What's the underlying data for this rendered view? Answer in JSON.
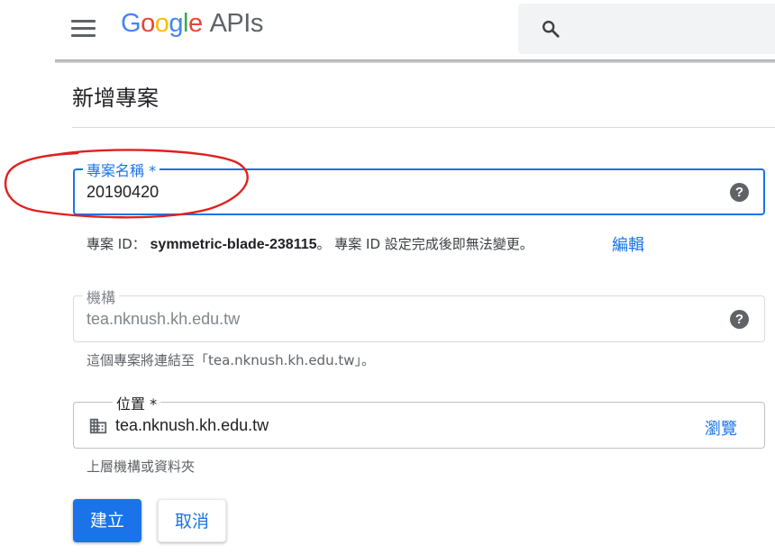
{
  "header": {
    "logo_google": [
      "G",
      "o",
      "o",
      "g",
      "l",
      "e"
    ],
    "logo_suffix": "APIs",
    "menu_icon": "hamburger-menu-icon",
    "search_icon": "search-icon"
  },
  "page": {
    "title": "新增專案"
  },
  "project_name": {
    "label": "專案名稱 *",
    "value": "20190420",
    "help_icon": "?"
  },
  "project_id": {
    "prefix": "專案 ID： ",
    "value": "symmetric-blade-238115",
    "suffix": "。 專案 ID 設定完成後即無法變更。",
    "edit_label": "編輯"
  },
  "organization": {
    "label": "機構",
    "value": "tea.nknush.kh.edu.tw",
    "help_icon": "?",
    "hint": "這個專案將連結至「tea.nknush.kh.edu.tw」。"
  },
  "location": {
    "label": "位置 *",
    "value": "tea.nknush.kh.edu.tw",
    "browse_label": "瀏覽",
    "hint": "上層機構或資料夾"
  },
  "actions": {
    "create_label": "建立",
    "cancel_label": "取消"
  },
  "colors": {
    "primary": "#1a73e8",
    "annotation": "#e02020"
  }
}
